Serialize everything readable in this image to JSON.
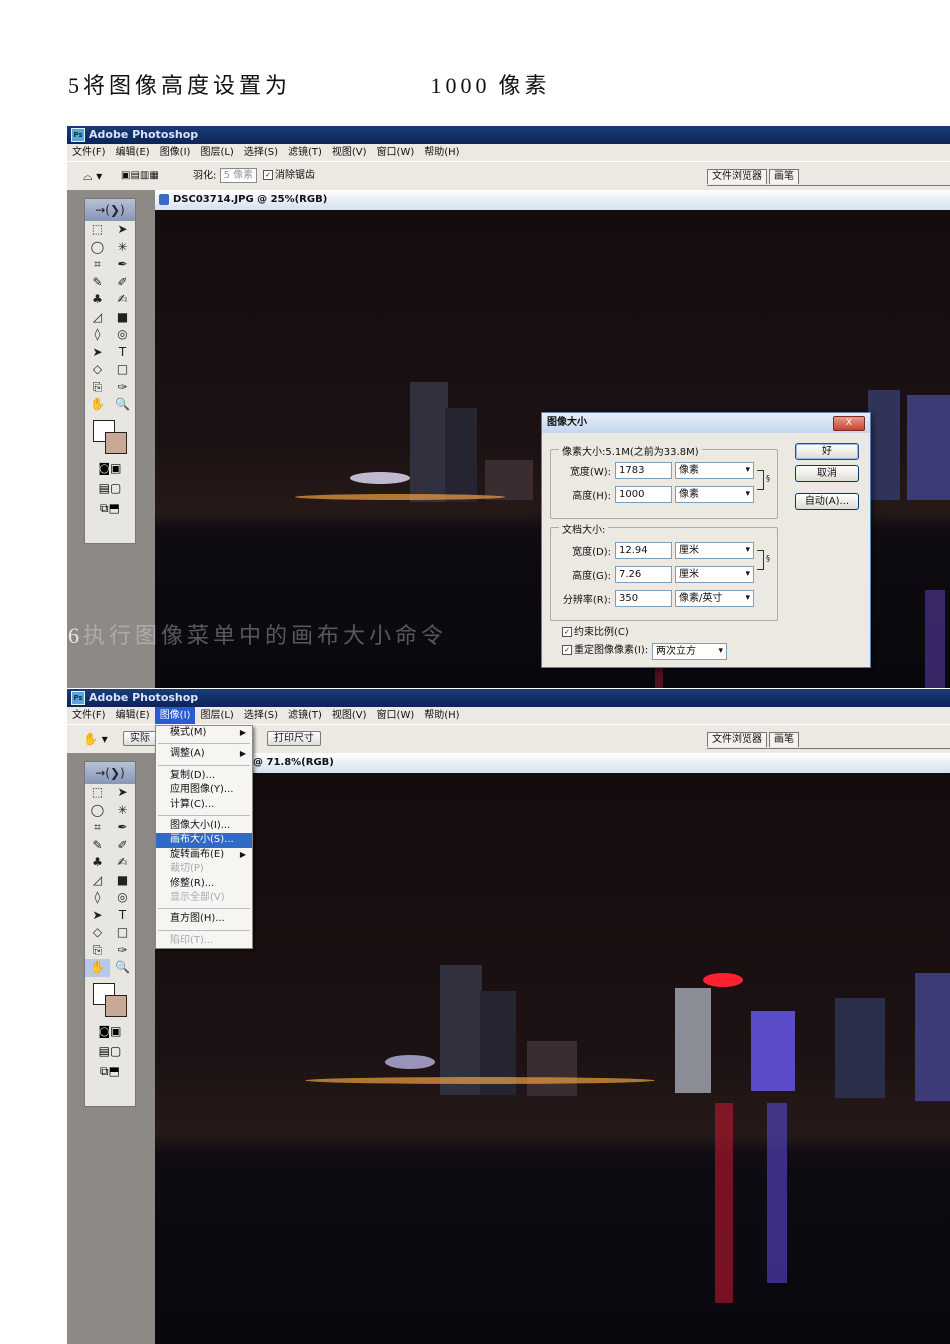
{
  "steps": [
    {
      "num": "5",
      "text": "将图像高度设置为",
      "value": "1000",
      "unit": "像素"
    },
    {
      "num": "6",
      "text": "执行图像菜单中的画布大小命令"
    }
  ],
  "app": {
    "title": "Adobe Photoshop",
    "icon": "photoshop-icon"
  },
  "menubar": [
    "文件(F)",
    "编辑(E)",
    "图像(I)",
    "图层(L)",
    "选择(S)",
    "滤镜(T)",
    "视图(V)",
    "窗口(W)",
    "帮助(H)"
  ],
  "options_bar_1": {
    "feather_label": "羽化:",
    "feather_value": "5 像素",
    "antialias_label": "消除锯齿"
  },
  "options_bar_2": {
    "actual_pixels": "实际",
    "print_size": "打印尺寸"
  },
  "palette_tabs": [
    "文件浏览器",
    "画笔"
  ],
  "doc1_title": "DSC03714.JPG @ 25%(RGB)",
  "doc2_title": "@ 71.8%(RGB)",
  "dialog": {
    "title": "图像大小",
    "close_label": "X",
    "pixel_dims_label": "像素大小:5.1M(之前为33.8M)",
    "width_label": "宽度(W):",
    "width_value": "1783",
    "width_unit": "像素",
    "height_label": "高度(H):",
    "height_value": "1000",
    "height_unit": "像素",
    "doc_size_label": "文档大小:",
    "doc_width_label": "宽度(D):",
    "doc_width_value": "12.94",
    "doc_width_unit": "厘米",
    "doc_height_label": "高度(G):",
    "doc_height_value": "7.26",
    "doc_height_unit": "厘米",
    "resolution_label": "分辨率(R):",
    "resolution_value": "350",
    "resolution_unit": "像素/英寸",
    "constrain_label": "约束比例(C)",
    "resample_label": "重定图像像素(I):",
    "resample_value": "两次立方",
    "ok_label": "好",
    "cancel_label": "取消",
    "auto_label": "自动(A)..."
  },
  "image_menu": [
    {
      "label": "模式(M)",
      "sub": true
    },
    {
      "sep": true
    },
    {
      "label": "调整(A)",
      "sub": true
    },
    {
      "sep": true
    },
    {
      "label": "复制(D)..."
    },
    {
      "label": "应用图像(Y)..."
    },
    {
      "label": "计算(C)..."
    },
    {
      "sep": true
    },
    {
      "label": "图像大小(I)..."
    },
    {
      "label": "画布大小(S)...",
      "highlighted": true
    },
    {
      "label": "旋转画布(E)",
      "sub": true
    },
    {
      "label": "裁切(P)",
      "disabled": true
    },
    {
      "label": "修整(R)..."
    },
    {
      "label": "显示全部(V)",
      "disabled": true
    },
    {
      "sep": true
    },
    {
      "label": "直方图(H)..."
    },
    {
      "sep": true
    },
    {
      "label": "陷印(T)...",
      "disabled": true
    }
  ],
  "tools": [
    "⬚",
    "➤",
    "◯",
    "✳",
    "⌗",
    "✒",
    "✎",
    "✐",
    "♣",
    "✍",
    "◿",
    "■",
    "◊",
    "◎",
    "➤",
    "T",
    "◇",
    "□",
    "⎘",
    "✑",
    "✋",
    "🔍"
  ],
  "toolbox_head": "→(❯)",
  "toolbox_modes": [
    "◙",
    "▣",
    "▤",
    "▢",
    "⧉",
    "⬒"
  ]
}
